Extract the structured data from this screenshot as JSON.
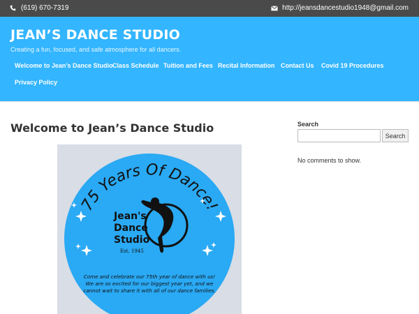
{
  "topbar": {
    "phone": "(619) 670-7319",
    "email": "http://jeansdancestudio1948@gmail.com",
    "phone_icon": "phone-icon",
    "email_icon": "envelope-icon"
  },
  "header": {
    "title": "JEAN’S DANCE STUDIO",
    "tagline": "Creating a fun, focused, and safe atmosphere for all dancers.",
    "background": "#33b5ff"
  },
  "nav": {
    "items": [
      "Welcome to Jean’s Dance Studio",
      "Class Schedule",
      "Tuition and Fees",
      "Recital Information",
      "Contact Us",
      "Covid 19 Procedures",
      "Privacy Policy"
    ]
  },
  "main": {
    "title": "Welcome to Jean’s Dance Studio",
    "image": {
      "arc_text": "75 Years Of Dance!",
      "logo_line1": "Jean's",
      "logo_line2": "Dance",
      "logo_line3": "Studio",
      "est": "Est. 1945",
      "body_line1": "Come and celebrate our 75th year of dance with us!",
      "body_line2": "We are so excited for our biggest year yet, and we",
      "body_line3": "cannot wait to share it with all of our dance families.",
      "circle_color": "#2aa9f4"
    }
  },
  "sidebar": {
    "search_label": "Search",
    "search_value": "",
    "search_placeholder": "",
    "search_button": "Search",
    "comments_text": "No comments to show."
  }
}
